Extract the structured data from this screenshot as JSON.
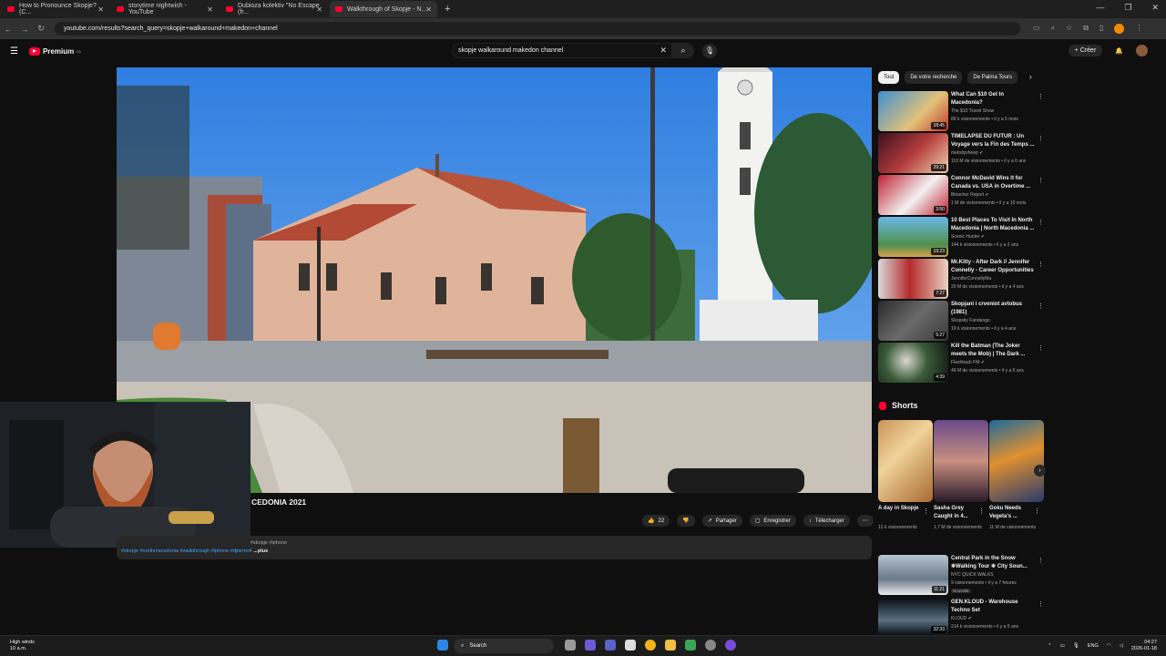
{
  "browser": {
    "tabs": [
      {
        "title": "How to Pronounce Skopje? (C..."
      },
      {
        "title": "storytime nightwish - YouTube"
      },
      {
        "title": "Dubioza kolektiv \"No Escape (fr..."
      },
      {
        "title": "Walkthrough of Skopje - N..."
      }
    ],
    "url": "youtube.com/results?search_query=skopje+walkaround+makedon+channel"
  },
  "header": {
    "brand": "Premium",
    "brand_sup": "CA",
    "search_value": "skopje walkaround makedon channel",
    "create_label": "Créer"
  },
  "video": {
    "title_visible": "CEDONIA 2021",
    "likes": "22",
    "share": "Partager",
    "save": "Enregistrer",
    "download": "Télécharger",
    "desc_line1": "#skopje #iphone",
    "desc_line2": "#skopje #northmacedonia #walkthrough #iphone #djisrmo4",
    "desc_more": "...plus"
  },
  "filters": [
    "Tout",
    "De votre recherche",
    "De Palma Tours"
  ],
  "recommended": [
    {
      "title": "What Can $10 Get In Macedonia?",
      "channel": "The $10 Travel Show",
      "meta": "89 k visionnements • il y a 5 mois",
      "duration": "18:45"
    },
    {
      "title": "TIMELAPSE DU FUTUR : Un Voyage vers la Fin des Temps ...",
      "channel": "melodysheep ✔",
      "meta": "110 M de visionnements • il y a 6 ans",
      "duration": "29:21"
    },
    {
      "title": "Connor McDavid Wins It for Canada vs. USA in Overtime ...",
      "channel": "Bleacher Report ✔",
      "meta": "1 M de visionnements • il y a 10 mois",
      "duration": "3:50"
    },
    {
      "title": "10 Best Places To Visit In North Macedonia | North Macedonia ...",
      "channel": "Scenic Hunter ✔",
      "meta": "144 k visionnements • il y a 2 ans",
      "duration": "19:23"
    },
    {
      "title": "Mr.Kitty - After Dark // Jennifer Connelly - Career Opportunities",
      "channel": "JenniferConnellyMa",
      "meta": "20 M de visionnements • il y a 4 ans",
      "duration": "7:27"
    },
    {
      "title": "Skopjani i crveniot avtobus (1981)",
      "channel": "Skopsky Fandango",
      "meta": "19 k visionnements • il y a 4 ans",
      "duration": "5:27"
    },
    {
      "title": "Kill the Batman (The Joker meets the Mob) | The Dark ...",
      "channel": "Flashback FM ✔",
      "meta": "49 M de visionnements • il y a 6 ans",
      "duration": "4:39"
    }
  ],
  "shorts": {
    "heading": "Shorts",
    "items": [
      {
        "title": "A day in Skopje",
        "views": "12 k visionnements"
      },
      {
        "title": "Sasha Grey Caught in 4...",
        "views": "1,7 M de visionnements"
      },
      {
        "title": "Goku Needs Vegeta's ...",
        "views": "11 M de visionnements"
      }
    ]
  },
  "recommended_lower": [
    {
      "title": "Central Park in the Snow ❄Walking Tour ❄ City Soun...",
      "channel": "NYC QUICK WALKS",
      "meta": "9 visionnements • il y a 7 heures",
      "badge": "Nouvelle",
      "duration": "11:21"
    },
    {
      "title": "GEN.KLOUD - Warehouse Techno Set",
      "channel": "KLOUD ✔",
      "meta": "214 k visionnements • il y a 5 ans",
      "duration": "32:33"
    }
  ],
  "taskbar": {
    "weather_line1": "High winds",
    "weather_line2": "10 a.m.",
    "search": "Search",
    "lang": "ENG",
    "time": "04:27",
    "date": "2026-01-18"
  },
  "colors": {
    "accent": "#ff0033",
    "background": "#0f0f0f",
    "chip": "#272727",
    "link": "#3ea6ff"
  }
}
